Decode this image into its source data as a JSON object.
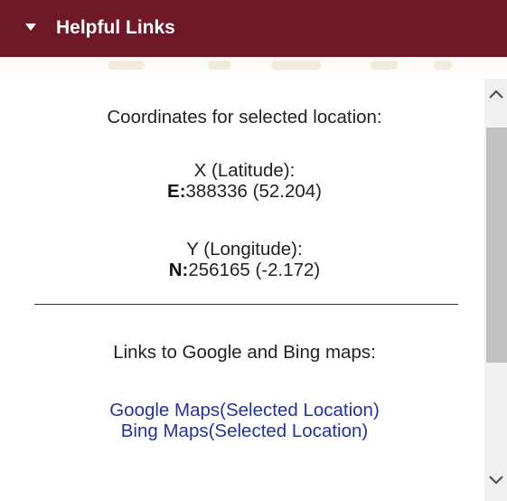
{
  "header": {
    "title": "Helpful Links",
    "caret_icon": "caret-down-icon",
    "background_color": "#6f1828"
  },
  "coordinates": {
    "heading": "Coordinates for selected location:",
    "x": {
      "label": "X (Latitude):",
      "prefix": "E:",
      "value": "388336 (52.204)"
    },
    "y": {
      "label": "Y (Longitude):",
      "prefix": "N:",
      "value": "256165 (-2.172)"
    }
  },
  "links": {
    "heading": "Links to Google and Bing maps:",
    "google": "Google Maps(Selected Location)",
    "bing": "Bing Maps(Selected Location)",
    "color": "#22349a"
  },
  "scrollbar": {
    "up_icon": "chevron-up-icon",
    "down_icon": "chevron-down-icon"
  }
}
